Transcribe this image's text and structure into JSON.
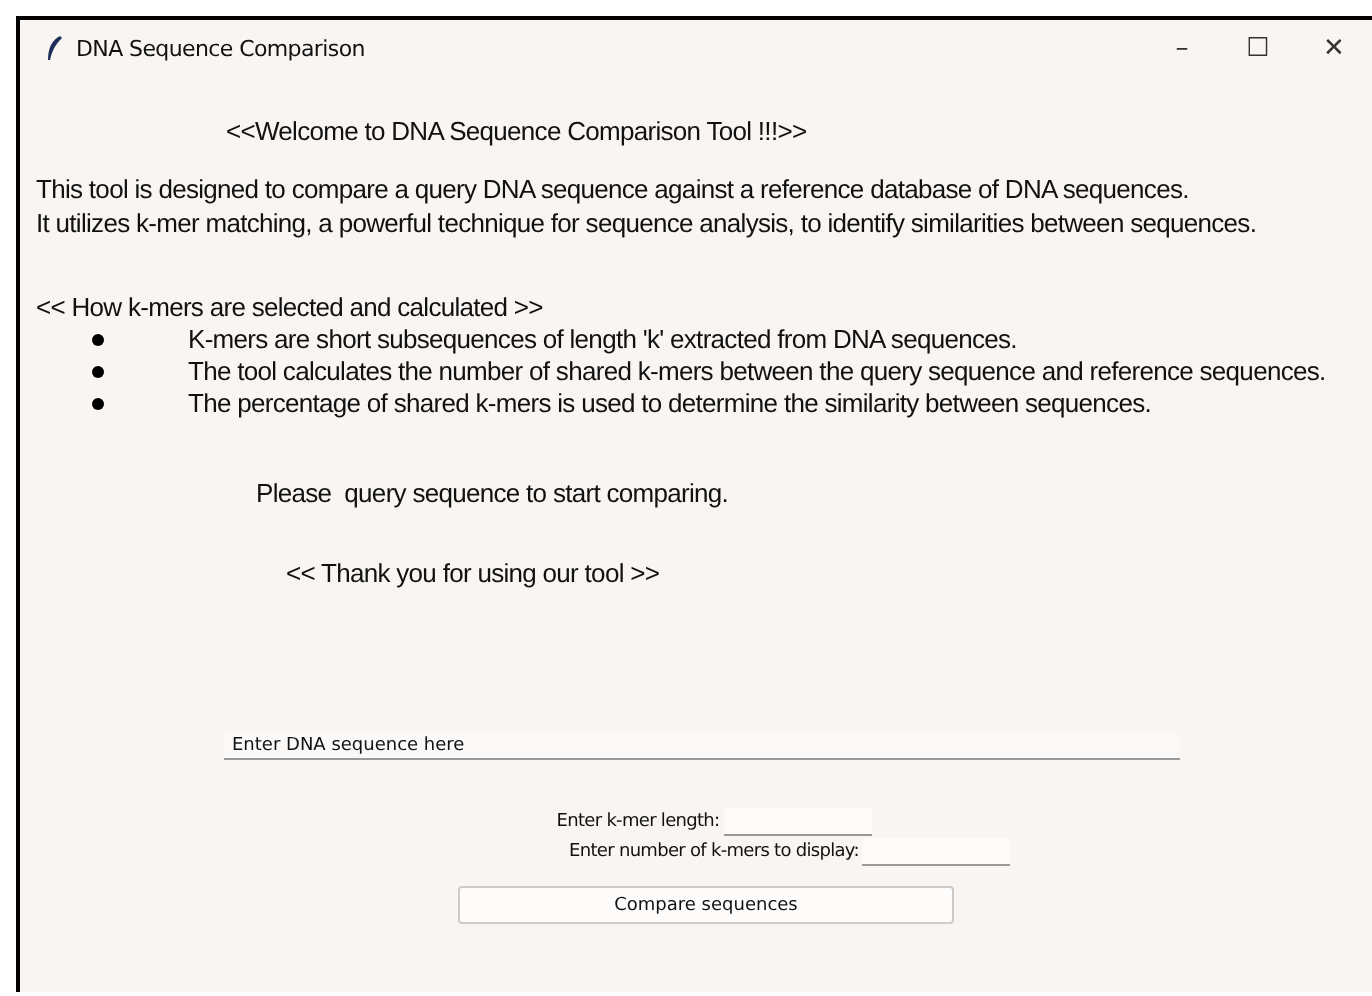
{
  "window": {
    "title": "DNA Sequence Comparison",
    "controls": [
      "–",
      "☐",
      "✕"
    ]
  },
  "welcome": "<<Welcome to DNA Sequence Comparison Tool !!!>>",
  "intro": [
    "This tool is designed to compare a query DNA sequence against a reference database of DNA sequences.",
    "It utilizes k-mer matching, a powerful technique for sequence analysis, to identify similarities between sequences."
  ],
  "kmers": {
    "heading": "<< How k-mers are selected and calculated >>",
    "bullets": [
      "K-mers are short subsequences of length 'k' extracted from DNA sequences.",
      "The tool calculates the number of shared k-mers between the query sequence and reference sequences.",
      "The percentage of shared k-mers is used to determine the similarity between sequences."
    ]
  },
  "prompt": "Please  query sequence to start comparing.",
  "thanks": "<< Thank you for using our tool >>",
  "sequence_field": {
    "value": "Enter DNA sequence here"
  },
  "kmer_length": {
    "label": "Enter k-mer length:"
  },
  "kmer_count": {
    "label": "Enter number of k-mers to display:"
  },
  "compare_button": "Compare sequences"
}
